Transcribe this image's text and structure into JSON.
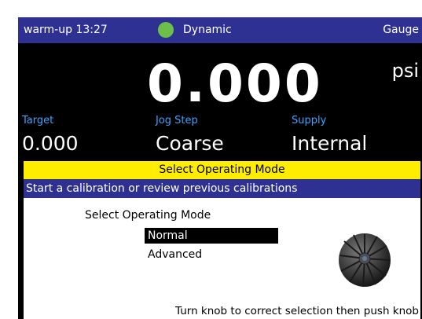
{
  "status_bar": {
    "warmup": "warm-up 13:27",
    "indicator_color": "#6cc04a",
    "mode": "Dynamic",
    "display": "Gauge"
  },
  "reading": {
    "value": "0.000",
    "unit": "psi"
  },
  "info": {
    "target_label": "Target",
    "target_value": "0.000",
    "jog_label": "Jog Step",
    "jog_value": "Coarse",
    "supply_label": "Supply",
    "supply_value": "Internal"
  },
  "dialog": {
    "title": "Select Operating Mode",
    "hint": "Start a calibration or review previous calibrations",
    "heading": "Select Operating Mode",
    "options": [
      {
        "label": "Normal",
        "selected": true
      },
      {
        "label": "Advanced",
        "selected": false
      }
    ],
    "knob_icon": "knob-icon",
    "instruction": "Turn knob to correct selection then push knob"
  },
  "colors": {
    "bar_blue": "#2e3192",
    "title_yellow": "#ffed00",
    "label_blue": "#3fa3ff"
  }
}
